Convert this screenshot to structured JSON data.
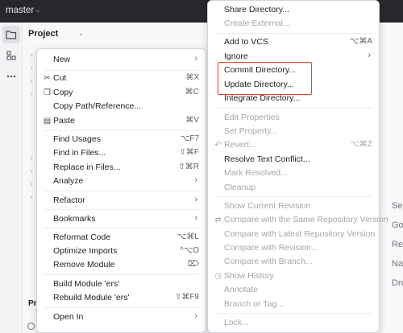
{
  "titlebar": {
    "branch": "master"
  },
  "project": {
    "title": "Project"
  },
  "bottom": {
    "fragment": "Pr"
  },
  "side_labels": [
    "Se",
    "Go",
    "Re",
    "Na",
    "Dro"
  ],
  "context_menu": [
    {
      "label": "New",
      "submenu": true
    },
    {
      "label": "Cut",
      "shortcut": "⌘X",
      "icon": "scissors-icon"
    },
    {
      "label": "Copy",
      "shortcut": "⌘C",
      "icon": "copy-icon"
    },
    {
      "label": "Copy Path/Reference..."
    },
    {
      "label": "Paste",
      "shortcut": "⌘V",
      "icon": "paste-icon"
    },
    {
      "label": "Find Usages",
      "shortcut": "⌥F7"
    },
    {
      "label": "Find in Files...",
      "shortcut": "⇧⌘F"
    },
    {
      "label": "Replace in Files...",
      "shortcut": "⇧⌘R"
    },
    {
      "label": "Analyze",
      "submenu": true
    },
    {
      "label": "Refactor",
      "submenu": true
    },
    {
      "label": "Bookmarks",
      "submenu": true
    },
    {
      "label": "Reformat Code",
      "shortcut": "⌥⌘L"
    },
    {
      "label": "Optimize Imports",
      "shortcut": "^⌥O"
    },
    {
      "label": "Remove Module",
      "shortcut": "⌦"
    },
    {
      "label": "Build Module 'ers'"
    },
    {
      "label": "Rebuild Module 'ers'",
      "shortcut": "⇧⌘F9"
    },
    {
      "label": "Open In",
      "submenu": true
    }
  ],
  "git_menu": [
    {
      "label": "Share Directory..."
    },
    {
      "label": "Create External...",
      "disabled": true
    },
    {
      "label": "Add to VCS",
      "shortcut": "⌥⌘A"
    },
    {
      "label": "Ignore",
      "submenu": true
    },
    {
      "label": "Commit Directory..."
    },
    {
      "label": "Update Directory..."
    },
    {
      "label": "Integrate Directory..."
    },
    {
      "label": "Edit Properties",
      "disabled": true
    },
    {
      "label": "Set Property...",
      "disabled": true
    },
    {
      "label": "Revert...",
      "shortcut": "⌥⌘Z",
      "disabled": true,
      "icon": "revert-icon"
    },
    {
      "label": "Resolve Text Conflict..."
    },
    {
      "label": "Mark Resolved...",
      "disabled": true
    },
    {
      "label": "Cleanup",
      "disabled": true
    },
    {
      "label": "Show Current Revision",
      "disabled": true
    },
    {
      "label": "Compare with the Same Repository Version",
      "disabled": true
    },
    {
      "label": "Compare with Latest Repository Version",
      "disabled": true
    },
    {
      "label": "Compare with Revision...",
      "disabled": true
    },
    {
      "label": "Compare with Branch...",
      "disabled": true
    },
    {
      "label": "Show History",
      "disabled": true,
      "icon": "history-icon"
    },
    {
      "label": "Annotate",
      "disabled": true
    },
    {
      "label": "Branch or Tag...",
      "disabled": true
    },
    {
      "label": "Lock...",
      "disabled": true
    }
  ],
  "colors": {
    "titlebar": "#27282c",
    "highlight": "#e0442f",
    "disabled_text": "#a3a6ad"
  }
}
